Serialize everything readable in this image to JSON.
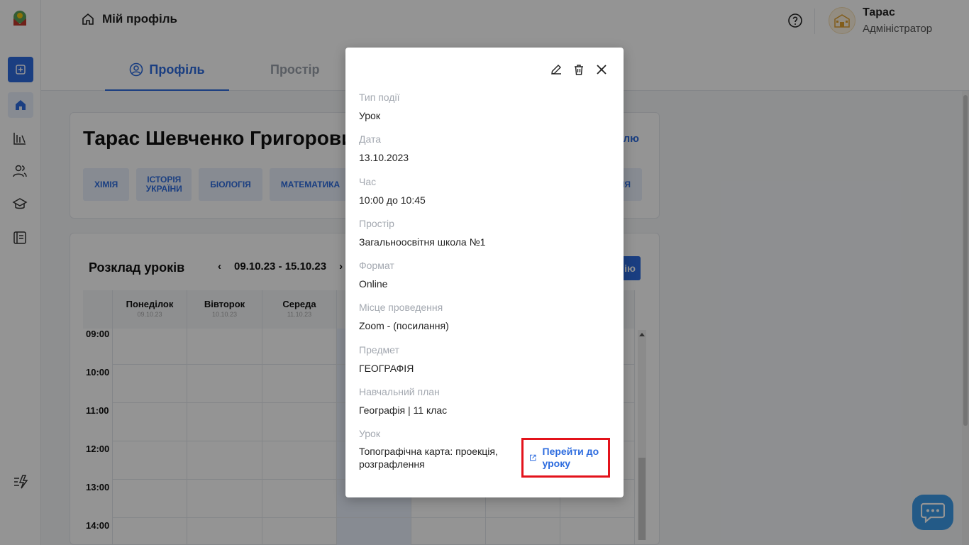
{
  "header": {
    "breadcrumb": "Мій профіль",
    "user_name": "Тарас",
    "user_role": "Адміністратор",
    "tabs": [
      {
        "label": "Профіль"
      },
      {
        "label": "Простір"
      }
    ]
  },
  "profile": {
    "full_name": "Тарас Шевченко Григорови",
    "edit_link": "ілю",
    "subjects": [
      "ХІМІЯ",
      "ІСТОРІЯ УКРАЇНИ",
      "БІОЛОГІЯ",
      "МАТЕМАТИКА"
    ],
    "subject_cut": "ІЯ"
  },
  "schedule": {
    "title": "Розклад уроків",
    "week": "09.10.23 - 15.10.23",
    "prev": "‹",
    "next": "›",
    "add_label": "ію",
    "days": [
      {
        "name": "Понеділок",
        "date": "09.10.23"
      },
      {
        "name": "Вівторок",
        "date": "10.10.23"
      },
      {
        "name": "Середа",
        "date": "11.10.23"
      }
    ],
    "times": [
      "09:00",
      "10:00",
      "11:00",
      "12:00",
      "13:00",
      "14:00"
    ]
  },
  "modal": {
    "fields": [
      {
        "label": "Тип події",
        "value": "Урок"
      },
      {
        "label": "Дата",
        "value": "13.10.2023"
      },
      {
        "label": "Час",
        "value": "10:00 до 10:45"
      },
      {
        "label": "Простір",
        "value": "Загальноосвітня школа №1"
      },
      {
        "label": "Формат",
        "value": "Online"
      },
      {
        "label": "Місце проведення",
        "value": "Zoom - (посилання)"
      },
      {
        "label": "Предмет",
        "value": "ГЕОГРАФІЯ"
      },
      {
        "label": "Навчальний план",
        "value": "Географія | 11 клас"
      }
    ],
    "lesson_label": "Урок",
    "lesson_value": "Топографічна карта: проекція, розграфлення",
    "go_to_lesson": "Перейти до уроку"
  },
  "colors": {
    "accent": "#2d6cdf",
    "highlight": "#e3131b",
    "chat": "#3d9be9"
  }
}
